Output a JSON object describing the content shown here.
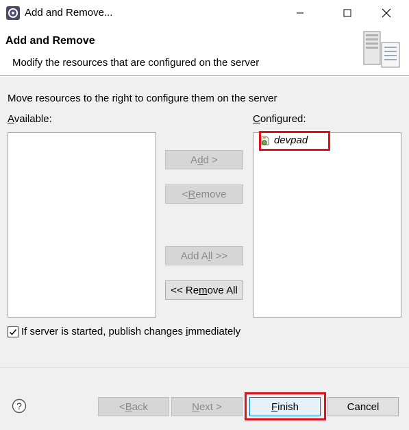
{
  "window": {
    "title": "Add and Remove..."
  },
  "banner": {
    "title": "Add and Remove",
    "description": "Modify the resources that are configured on the server"
  },
  "main": {
    "instruction": "Move resources to the right to configure them on the server",
    "available_label_prefix": "",
    "available_label_mnemonic": "A",
    "available_label_rest": "vailable:",
    "configured_label_mnemonic": "C",
    "configured_label_rest": "onfigured:",
    "available_items": [],
    "configured_items": [
      {
        "label": "devpad",
        "icon": "project-module-icon",
        "highlighted": true
      }
    ]
  },
  "buttons": {
    "add": {
      "pre": "A",
      "mn": "d",
      "post": "d >",
      "enabled": false
    },
    "remove": {
      "pre": "< ",
      "mn": "R",
      "post": "emove",
      "enabled": false
    },
    "add_all": {
      "pre": "Add A",
      "mn": "l",
      "post": "l >>",
      "enabled": false
    },
    "remove_all": {
      "pre": "<< Re",
      "mn": "m",
      "post": "ove All",
      "enabled": true
    }
  },
  "publish_checkbox": {
    "checked": true,
    "label_pre": "If server is started, publish changes ",
    "label_mn": "i",
    "label_post": "mmediately"
  },
  "footer": {
    "back": {
      "pre": "< ",
      "mn": "B",
      "post": "ack",
      "enabled": false
    },
    "next": {
      "pre": "",
      "mn": "N",
      "post": "ext >",
      "enabled": false
    },
    "finish": {
      "pre": "",
      "mn": "F",
      "post": "inish",
      "enabled": true,
      "highlighted": true
    },
    "cancel": {
      "label": "Cancel",
      "enabled": true
    }
  },
  "colors": {
    "highlight_red": "#e0101c",
    "dialog_bg": "#f0f0f0",
    "default_button_border": "#0078d7"
  }
}
